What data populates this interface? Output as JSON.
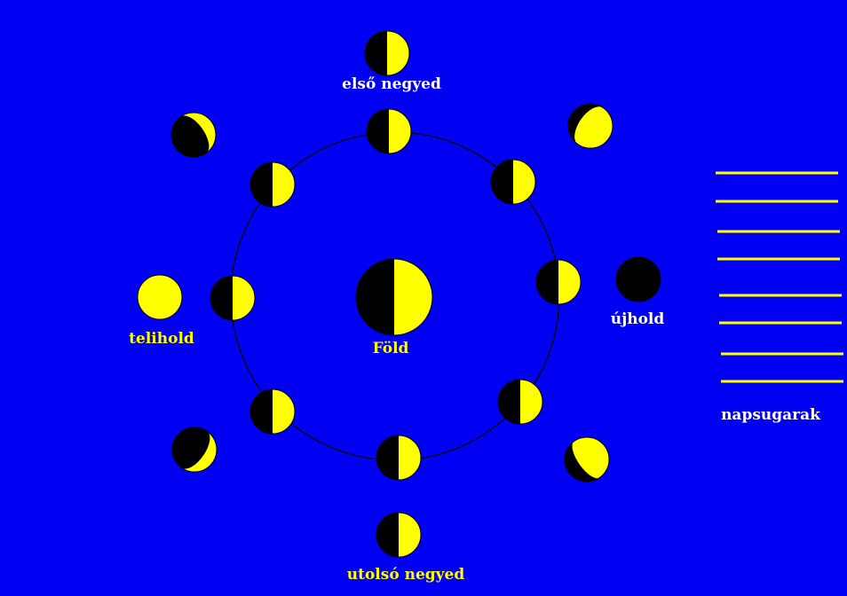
{
  "labels": {
    "first_quarter": "első negyed",
    "earth": "Föld",
    "full_moon": "telihold",
    "new_moon": "újhold",
    "sun_rays": "napsugarak",
    "last_quarter": "utolsó negyed"
  },
  "colors": {
    "background": "#0000f2",
    "lit": "#ffff00",
    "dark": "#000000",
    "orbit": "#000000",
    "ray": "#ffff00"
  }
}
